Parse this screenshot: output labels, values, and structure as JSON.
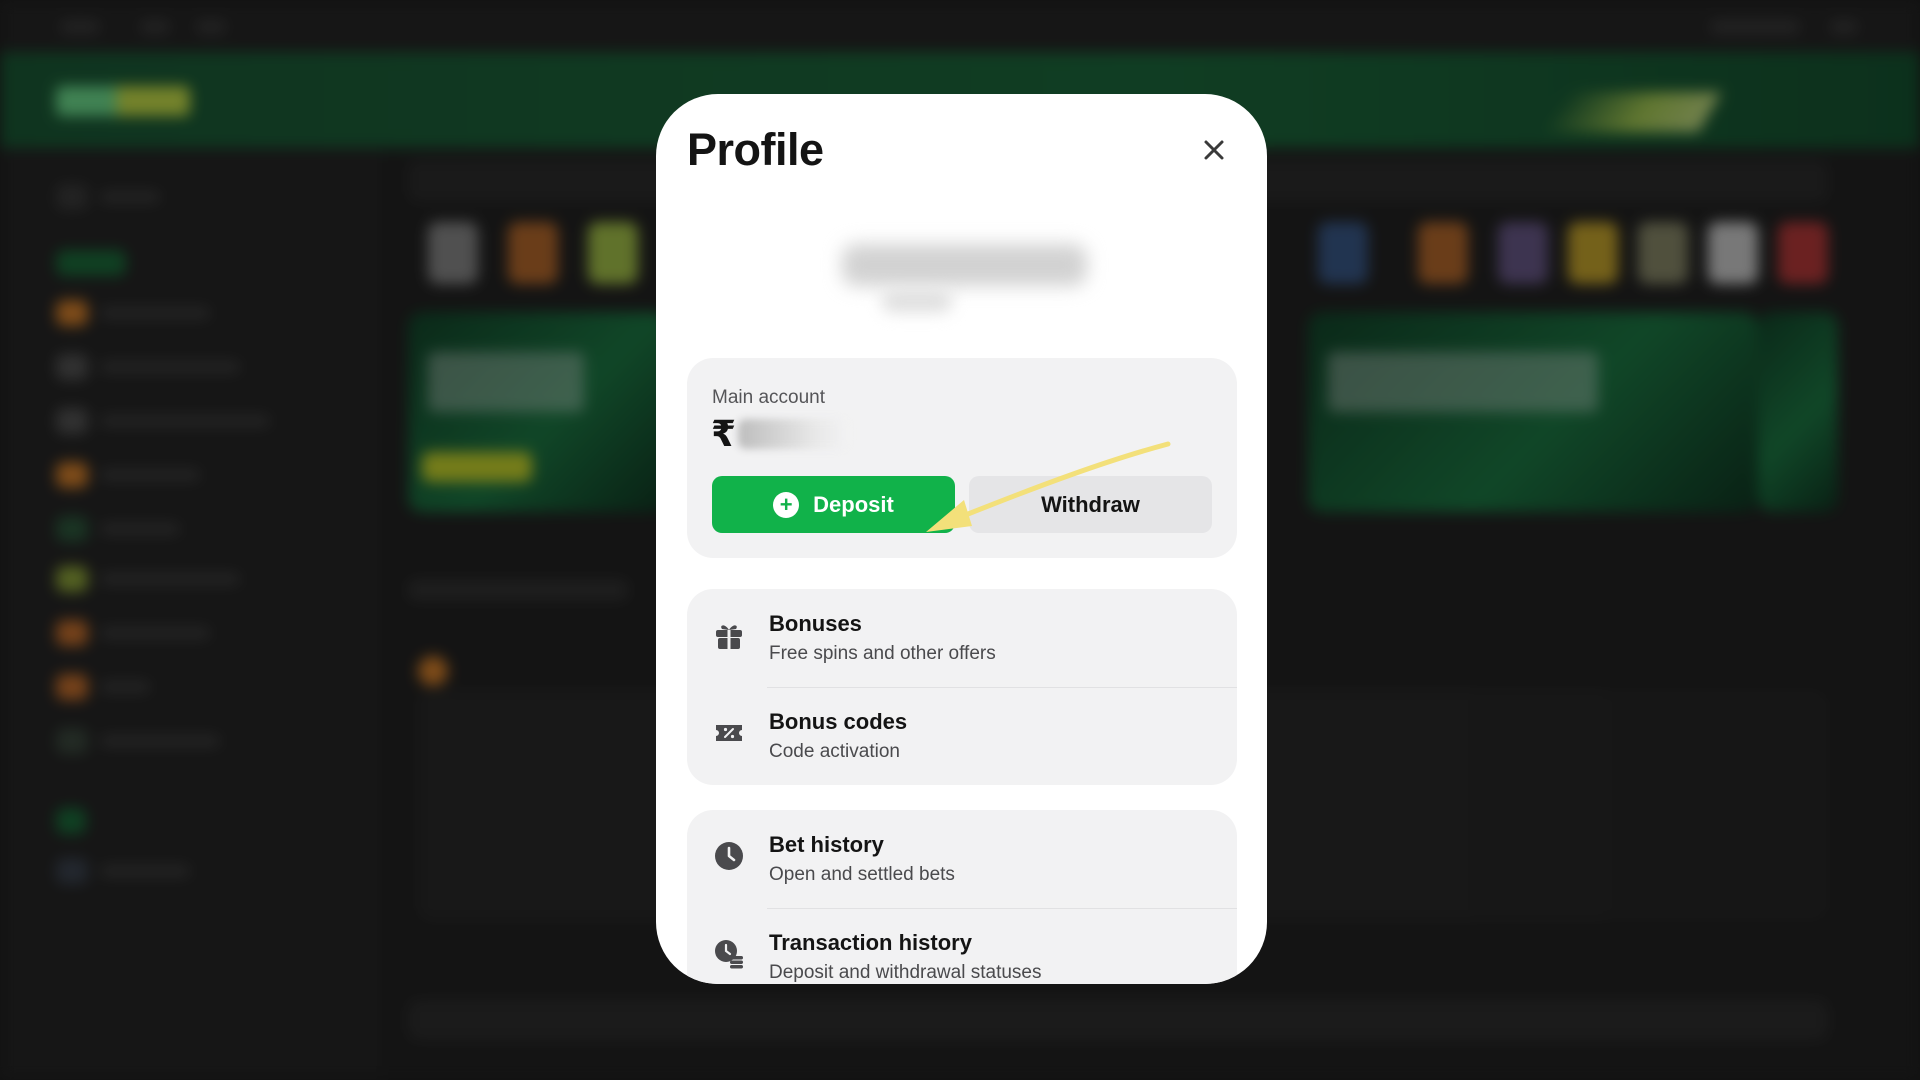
{
  "profile_modal": {
    "title": "Profile",
    "close_icon": "close-icon",
    "main_account": {
      "label": "Main account",
      "currency_symbol": "₹",
      "deposit_label": "Deposit",
      "withdraw_label": "Withdraw"
    },
    "menu_groups": [
      {
        "items": [
          {
            "icon": "gift-icon",
            "title": "Bonuses",
            "subtitle": "Free spins and other offers"
          },
          {
            "icon": "percent-ticket-icon",
            "title": "Bonus codes",
            "subtitle": "Code activation"
          }
        ]
      },
      {
        "items": [
          {
            "icon": "clock-icon",
            "title": "Bet history",
            "subtitle": "Open and settled bets"
          },
          {
            "icon": "coins-icon",
            "title": "Transaction history",
            "subtitle": "Deposit and withdrawal statuses"
          }
        ]
      }
    ]
  },
  "colors": {
    "deposit_green": "#11b24a",
    "header_green": "#1d6a3d",
    "annotation_arrow": "#f3e07a",
    "modal_bg": "#ffffff",
    "card_bg": "#f2f2f3"
  }
}
